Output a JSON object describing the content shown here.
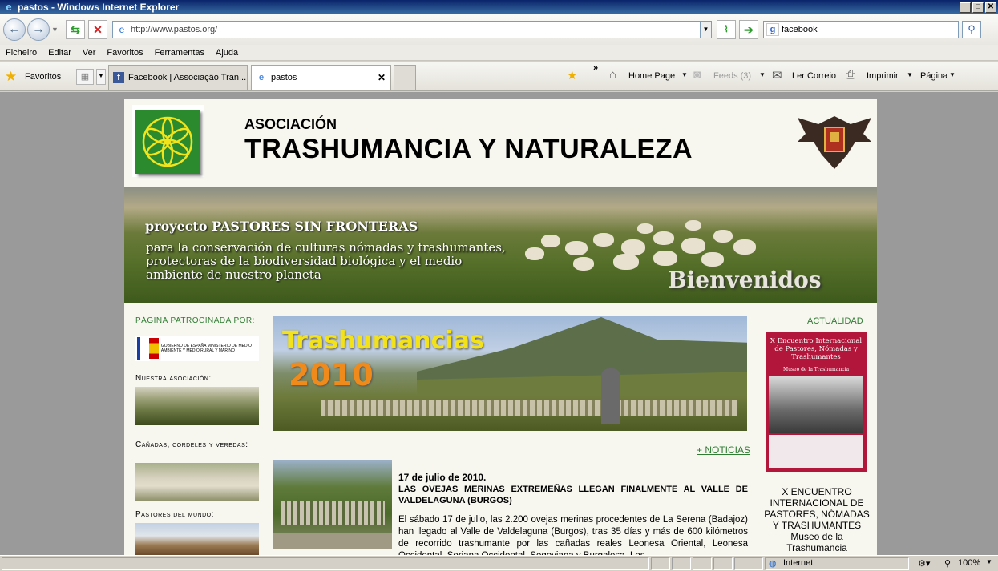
{
  "window": {
    "title": "pastos - Windows Internet Explorer",
    "min": "_",
    "max": "□",
    "close": "✕"
  },
  "nav": {
    "url": "http://www.pastos.org/",
    "search_value": "facebook"
  },
  "menu": [
    "Ficheiro",
    "Editar",
    "Ver",
    "Favoritos",
    "Ferramentas",
    "Ajuda"
  ],
  "tabs": {
    "favorites_label": "Favoritos",
    "items": [
      {
        "title": "Facebook | Associação Tran..."
      },
      {
        "title": "pastos"
      }
    ]
  },
  "commands": {
    "home": "Home Page",
    "feeds": "Feeds (3)",
    "mail": "Ler Correio",
    "print": "Imprimir",
    "page": "Página"
  },
  "header": {
    "assoc": "ASOCIACIÓN",
    "name": "TRASHUMANCIA Y NATURALEZA"
  },
  "banner": {
    "line1_a": "proyecto ",
    "line1_b": "PASTORES SIN FRONTERAS",
    "sub": "para la conservación de culturas nómadas y trashumantes, protectoras de la biodiversidad biológica y el medio ambiente de nuestro planeta",
    "welcome": "Bienvenidos"
  },
  "left": {
    "sponsor_head": "PÁGINA PATROCINADA POR:",
    "sponsor_text": "GOBIERNO DE ESPAÑA   MINISTERIO DE MEDIO AMBIENTE Y MEDIO RURAL Y MARINO",
    "section1": "Nuestra asociación:",
    "section2": "Cañadas, cordeles y veredas:",
    "section3": "Pastores del mundo:"
  },
  "middle": {
    "title1": "Trashumancias",
    "title2": "2010",
    "more_news": "+ NOTICIAS",
    "news": {
      "date": "17 de julio de 2010.",
      "headline": "LAS OVEJAS MERINAS EXTREMEÑAS LLEGAN FINALMENTE AL VALLE DE VALDELAGUNA (BURGOS)",
      "body": "El sábado 17 de julio, las 2.200 ovejas merinas procedentes de La Serena (Badajoz) han llegado al Valle de Valdelaguna (Burgos), tras 35 días y más de 600 kilómetros de recorrido trashumante por las cañadas reales Leonesa Oriental, Leonesa Occidental, Soriana Occidental, Segoviana y Burgalesa. Los"
    }
  },
  "right": {
    "head": "ACTUALIDAD",
    "poster_title": "X Encuentro Internacional de Pastores, Nómadas y Trashumantes",
    "poster_sub": "Museo de la Trashumancia",
    "text": "X ENCUENTRO INTERNACIONAL DE PASTORES, NÓMADAS Y TRASHUMANTES",
    "text2": "Museo de la Trashumancia"
  },
  "status": {
    "zone": "Internet",
    "zoom": "100%"
  },
  "colors": {
    "titlebar": "#0a246a",
    "green": "#2e7d32",
    "poster": "#b2163b"
  }
}
